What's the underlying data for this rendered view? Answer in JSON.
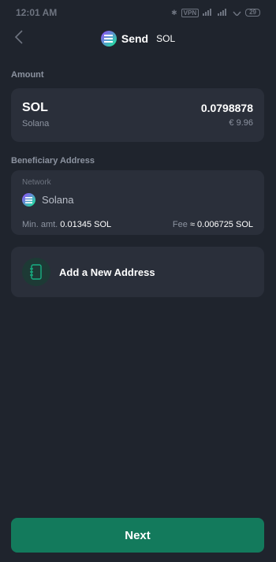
{
  "status_bar": {
    "time": "12:01 AM",
    "vpn": "VPN",
    "battery": "29"
  },
  "header": {
    "title": "Send",
    "subtitle": "SOL",
    "logo_icon": "solana-logo-icon",
    "back_icon": "chevron-left-icon"
  },
  "amount_section": {
    "label": "Amount",
    "asset_symbol": "SOL",
    "asset_name": "Solana",
    "amount": "0.0798878",
    "fiat": "€ 9.96"
  },
  "beneficiary_section": {
    "label": "Beneficiary Address",
    "network_label": "Network",
    "network_name": "Solana",
    "min_amount_label": "Min. amt.",
    "min_amount_value": "0.01345 SOL",
    "fee_label": "Fee",
    "fee_value": "≈ 0.006725 SOL"
  },
  "add_address": {
    "label": "Add a New Address",
    "icon": "address-book-icon"
  },
  "next_button": {
    "label": "Next"
  },
  "colors": {
    "background": "#1f242d",
    "card": "#2a2f3a",
    "accent": "#137a5c",
    "muted_text": "#8c93a0"
  }
}
